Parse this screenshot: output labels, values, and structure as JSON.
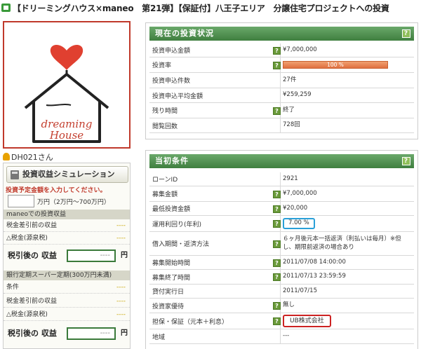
{
  "title": "【ドリーミングハウス×maneo　第21弾】【保証付】八王子エリア　分譲住宅プロジェクトへの投資",
  "user": "DH021さん",
  "logo_text": "dreaming House",
  "simulation": {
    "button": "投資収益シミュレーション",
    "note": "投資予定金額を入力してください。",
    "amount_value": "",
    "amount_unit": "万円（2万円〜700万円）",
    "maneo_header": "maneoでの投資収益",
    "pretax": "税金差引前の収益",
    "tax": "△税金(源泉税)",
    "net": "税引後の 収益",
    "dash": "----",
    "yen": "円",
    "bank_header": "銀行定期スーパー定期(300万円未満)",
    "condition": "条件"
  },
  "status": {
    "header": "現在の投資状況",
    "rows": [
      {
        "k": "投資申込金額",
        "v": "¥7,000,000",
        "help": true
      },
      {
        "k": "投資率",
        "v": "100 %",
        "help": true,
        "bar": 1.0
      },
      {
        "k": "投資申込件数",
        "v": "27件",
        "help": false
      },
      {
        "k": "投資申込平均金額",
        "v": "¥259,259",
        "help": false
      },
      {
        "k": "残り時間",
        "v": "終了",
        "help": true
      },
      {
        "k": "閲覧回数",
        "v": "728回",
        "help": false
      }
    ]
  },
  "terms": {
    "header": "当初条件",
    "rows": [
      {
        "k": "ローンID",
        "v": "2921",
        "help": false
      },
      {
        "k": "募集金額",
        "v": "¥7,000,000",
        "help": true
      },
      {
        "k": "最低投資金額",
        "v": "¥20,000",
        "help": true
      },
      {
        "k": "運用利回り(年利)",
        "v": "7.00 %",
        "help": true
      },
      {
        "k": "借入期間・返済方法",
        "v": "６ヶ月後元本一括返済（利払いは毎月）※但し、期限前返済の場合あり",
        "help": true
      },
      {
        "k": "募集開始時間",
        "v": "2011/07/08 14:00:00",
        "help": true
      },
      {
        "k": "募集終了時間",
        "v": "2011/07/13 23:59:59",
        "help": true
      },
      {
        "k": "貸付実行日",
        "v": "2011/07/15",
        "help": false
      },
      {
        "k": "投資家優待",
        "v": "無し",
        "help": true
      },
      {
        "k": "担保・保証（元本＋利息）",
        "v": "UB株式会社",
        "help": true
      },
      {
        "k": "地域",
        "v": "---",
        "help": false
      }
    ]
  },
  "colors": {
    "accent_green": "#3f7f3f",
    "progress": "#e07040",
    "highlight_blue": "#2aa0d8",
    "highlight_red": "#cc2222"
  }
}
